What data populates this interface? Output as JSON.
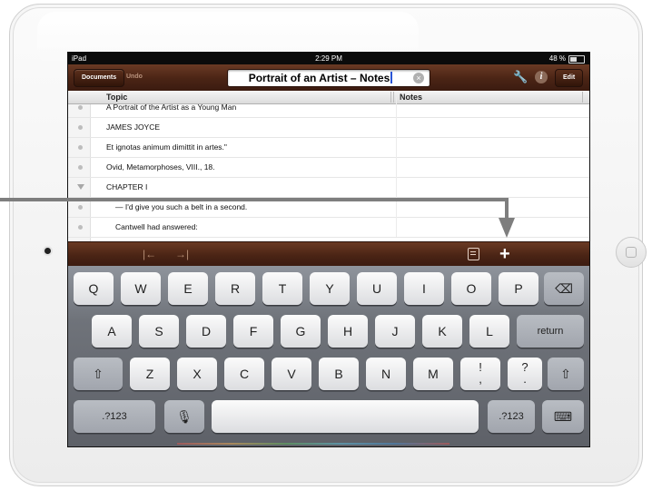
{
  "status_bar": {
    "carrier": "iPad",
    "time": "2:29 PM",
    "battery": "48 %"
  },
  "navbar": {
    "documents": "Documents",
    "undo": "Undo",
    "title": "Portrait of an Artist – Notes",
    "edit": "Edit"
  },
  "columns": {
    "topic": "Topic",
    "notes": "Notes"
  },
  "rows": [
    "A Portrait of the Artist as a Young Man",
    "JAMES JOYCE",
    "Et ignotas animum dimittit in artes.\"",
    "Ovid, Metamorphoses, VIII., 18.",
    "CHAPTER I",
    "— I'd give you such a belt in a second.",
    "Cantwell had answered:"
  ],
  "accessory": {
    "outdent": "|←",
    "indent": "→|",
    "add": "+"
  },
  "keyboard": {
    "row1": [
      "Q",
      "W",
      "E",
      "R",
      "T",
      "Y",
      "U",
      "I",
      "O",
      "P"
    ],
    "row2": [
      "A",
      "S",
      "D",
      "F",
      "G",
      "H",
      "J",
      "K",
      "L"
    ],
    "return": "return",
    "row3": [
      "Z",
      "X",
      "C",
      "V",
      "B",
      "N",
      "M"
    ],
    "punct1_top": "!",
    "punct1_bottom": ",",
    "punct2_top": "?",
    "punct2_bottom": ".",
    "numbers": ".?123"
  },
  "icons": {
    "wrench": "wrench-icon",
    "info": "info-icon",
    "clear": "clear-icon",
    "backspace": "backspace-icon",
    "shift": "shift-icon",
    "mic": "microphone-icon",
    "hide": "hide-keyboard-icon"
  }
}
